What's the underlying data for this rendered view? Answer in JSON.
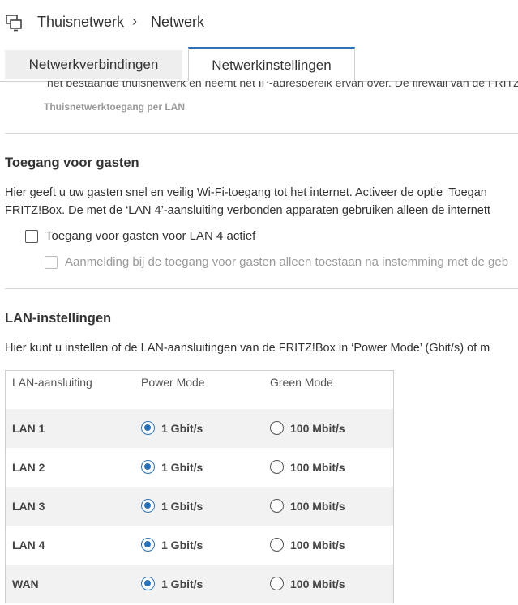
{
  "breadcrumb": {
    "home": "Thuisnetwerk",
    "current": "Netwerk"
  },
  "tabs": [
    {
      "label": "Netwerkverbindingen",
      "active": false
    },
    {
      "label": "Netwerkinstellingen",
      "active": true
    }
  ],
  "top": {
    "cut_text": "het bestaande thuisnetwerk en neemt het IP-adresbereik ervan over. De firewall van de FRITZ!Bo",
    "label": "Thuisnetwerktoegang per LAN"
  },
  "guest": {
    "title": "Toegang voor gasten",
    "para1": "Hier geeft u uw gasten snel en veilig Wi-Fi-toegang tot het internet. Activeer de optie ‘Toegan",
    "para2": "FRITZ!Box. De met de ‘LAN 4’-aansluiting verbonden apparaten gebruiken alleen de internett",
    "check1": "Toegang voor gasten voor LAN 4 actief",
    "check2": "Aanmelding bij de toegang voor gasten alleen toestaan na instemming met de geb"
  },
  "lan": {
    "title": "LAN-instellingen",
    "para": "Hier kunt u instellen of de LAN-aansluitingen van de FRITZ!Box in ‘Power Mode’ (Gbit/s) of m",
    "headers": [
      "LAN-aansluiting",
      "Power Mode",
      "Green Mode"
    ],
    "rows": [
      {
        "name": "LAN 1",
        "power": "1 Gbit/s",
        "green": "100 Mbit/s",
        "selected": "power"
      },
      {
        "name": "LAN 2",
        "power": "1 Gbit/s",
        "green": "100 Mbit/s",
        "selected": "power"
      },
      {
        "name": "LAN 3",
        "power": "1 Gbit/s",
        "green": "100 Mbit/s",
        "selected": "power"
      },
      {
        "name": "LAN 4",
        "power": "1 Gbit/s",
        "green": "100 Mbit/s",
        "selected": "power"
      },
      {
        "name": "WAN",
        "power": "1 Gbit/s",
        "green": "100 Mbit/s",
        "selected": "power"
      }
    ]
  },
  "colors": {
    "accent": "#2c72b8",
    "divider": "#d4d4d4",
    "row_alt": "#f2f2f2"
  }
}
